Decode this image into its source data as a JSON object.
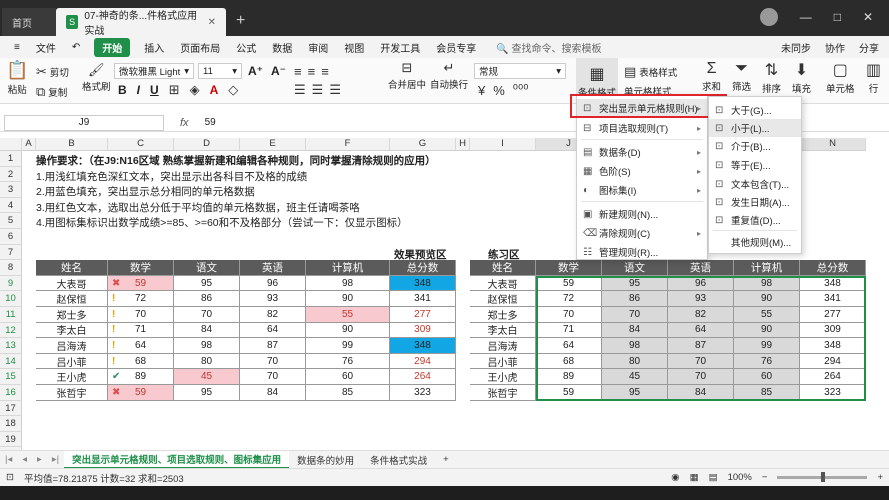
{
  "titlebar": {
    "home_tab": "首页",
    "doc_tab": "07-神奇的条...件格式应用实战",
    "doc_icon": "S",
    "new_tab": "+"
  },
  "menubar": {
    "file": "文件",
    "start": "开始",
    "items": [
      "插入",
      "页面布局",
      "公式",
      "数据",
      "审阅",
      "视图",
      "开发工具",
      "会员专享"
    ],
    "search": "查找命令、搜索模板",
    "right": [
      "未同步",
      "协作",
      "分享"
    ]
  },
  "ribbon": {
    "cut": "剪切",
    "copy": "复制",
    "format_painter": "格式刷",
    "paste": "粘贴",
    "font_name": "微软雅黑 Light",
    "font_size": "11",
    "merge": "合并居中",
    "wrap": "自动换行",
    "number_format": "常规",
    "cond_format": "条件格式",
    "table_style": "表格样式",
    "cell_style": "单元格样式",
    "sum": "求和",
    "filter": "筛选",
    "sort": "排序",
    "fill": "填充",
    "cell": "单元格",
    "row_col": "行"
  },
  "formula_bar": {
    "name_box": "J9",
    "fx": "fx",
    "value": "59"
  },
  "grid": {
    "columns": [
      "A",
      "B",
      "C",
      "D",
      "E",
      "F",
      "G",
      "H",
      "I",
      "J",
      "K",
      "L",
      "M",
      "N"
    ],
    "rows": [
      "1",
      "2",
      "3",
      "4",
      "5",
      "6",
      "7",
      "8",
      "9",
      "10",
      "11",
      "12",
      "13",
      "14",
      "15",
      "16",
      "17",
      "18",
      "19",
      "20"
    ],
    "instructions": [
      "操作要求：（在J9:N16区域 熟练掌握新建和编辑各种规则，同时掌握清除规则的应用）",
      "1.用浅红填充色深红文本，突出显示出各科目不及格的成绩",
      "2.用蓝色填充，突出显示总分相同的单元格数据",
      "3.用红色文本，选取出总分低于平均值的单元格数据，班主任请喝茶咯",
      "4.用图标集标识出数学成绩>=85、>=60和不及格部分（尝试一下：仅显示图标）"
    ],
    "preview_label": "效果预览区",
    "practice_label": "练习区",
    "headers": [
      "姓名",
      "数学",
      "语文",
      "英语",
      "计算机",
      "总分数"
    ],
    "students": [
      {
        "name": "大表哥",
        "math": "59",
        "chinese": "95",
        "english": "96",
        "computer": "98",
        "total": "348",
        "icon": "✖"
      },
      {
        "name": "赵保恒",
        "math": "72",
        "chinese": "86",
        "english": "93",
        "computer": "90",
        "total": "341",
        "icon": "!"
      },
      {
        "name": "郑士多",
        "math": "70",
        "chinese": "70",
        "english": "82",
        "computer": "55",
        "total": "277",
        "icon": "!"
      },
      {
        "name": "李太白",
        "math": "71",
        "chinese": "84",
        "english": "64",
        "computer": "90",
        "total": "309",
        "icon": "!"
      },
      {
        "name": "吕海涛",
        "math": "64",
        "chinese": "98",
        "english": "87",
        "computer": "99",
        "total": "348",
        "icon": "!"
      },
      {
        "name": "吕小菲",
        "math": "68",
        "chinese": "80",
        "english": "70",
        "computer": "76",
        "total": "294",
        "icon": "!"
      },
      {
        "name": "王小虎",
        "math": "89",
        "chinese": "45",
        "english": "70",
        "computer": "60",
        "total": "264",
        "icon": "✔"
      },
      {
        "name": "张哲宇",
        "math": "59",
        "chinese": "95",
        "english": "84",
        "computer": "85",
        "total": "323",
        "icon": "✖"
      }
    ],
    "practice_headers_visible": [
      "姓名",
      "数学",
      "语文",
      "英语",
      "计算机",
      "总分数"
    ]
  },
  "menus": {
    "main": [
      {
        "label": "突出显示单元格规则(H)",
        "icon": "highlight-rules-icon",
        "arrow": "▸"
      },
      {
        "label": "项目选取规则(T)",
        "icon": "top-bottom-rules-icon",
        "arrow": "▸"
      },
      {
        "label": "数据条(D)",
        "icon": "data-bars-icon",
        "arrow": "▸"
      },
      {
        "label": "色阶(S)",
        "icon": "color-scales-icon",
        "arrow": "▸"
      },
      {
        "label": "图标集(I)",
        "icon": "icon-sets-icon",
        "arrow": "▸"
      },
      {
        "label": "新建规则(N)...",
        "icon": "new-rule-icon",
        "arrow": ""
      },
      {
        "label": "清除规则(C)",
        "icon": "clear-rules-icon",
        "arrow": "▸"
      },
      {
        "label": "管理规则(R)...",
        "icon": "manage-rules-icon",
        "arrow": ""
      }
    ],
    "sub": [
      {
        "label": "大于(G)..."
      },
      {
        "label": "小于(L)..."
      },
      {
        "label": "介于(B)..."
      },
      {
        "label": "等于(E)..."
      },
      {
        "label": "文本包含(T)..."
      },
      {
        "label": "发生日期(A)..."
      },
      {
        "label": "重复值(D)..."
      },
      {
        "label": "其他规则(M)..."
      }
    ]
  },
  "sheet_tabs": [
    "突出显示单元格规则、项目选取规则、图标集应用",
    "数据条的妙用",
    "条件格式实战"
  ],
  "status": {
    "summary": "平均值=78.21875  计数=32  求和=2503",
    "zoom": "100%"
  },
  "colors": {
    "accent": "#1f8f4a",
    "header_fill": "#5b5b5b",
    "light_red": "#f8c9cf",
    "blue_fill": "#12a6e4",
    "red_text": "#c0392b",
    "highlight_box": "#e0242c"
  }
}
